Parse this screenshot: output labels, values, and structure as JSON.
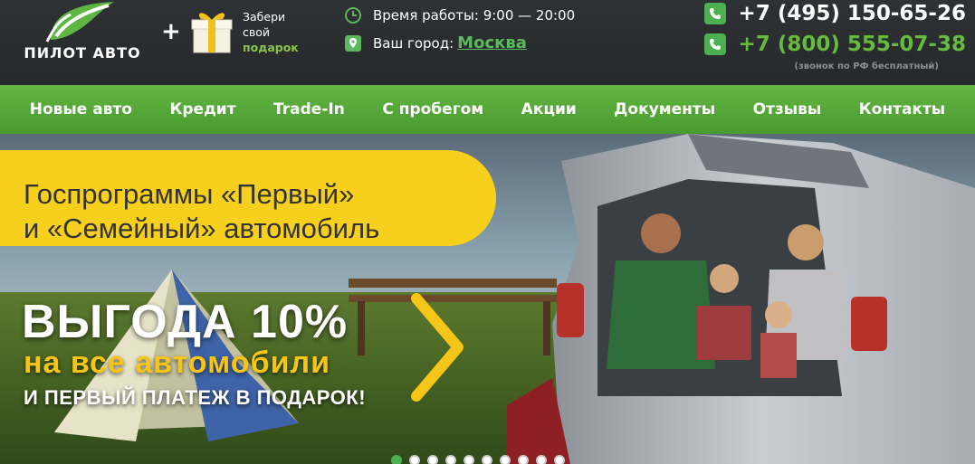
{
  "header": {
    "logo_text": "ПИЛОТ АВТО",
    "plus": "+",
    "gift": {
      "line1": "Забери",
      "line2": "свой",
      "line3": "подарок"
    },
    "hours": "Время работы: 9:00 — 20:00",
    "city_label": "Ваш город:",
    "city": "Москва",
    "phone1": "+7 (495) 150-65-26",
    "phone2": "+7 (800) 555-07-38",
    "phone_note": "(звонок по РФ бесплатный)"
  },
  "nav": {
    "items": [
      "Новые авто",
      "Кредит",
      "Trade-In",
      "С пробегом",
      "Акции",
      "Документы",
      "Отзывы",
      "Контакты"
    ]
  },
  "hero": {
    "banner_line1": "Госпрограммы «Первый»",
    "banner_line2": "и «Семейный» автомобиль",
    "benefit_big": "ВЫГОДА 10%",
    "benefit_yellow": "на все автомобили",
    "benefit_white": "И ПЕРВЫЙ ПЛАТЕЖ В ПОДАРОК!",
    "slide_count": 10,
    "active_slide": 0
  },
  "colors": {
    "accent_green": "#5cb85c",
    "nav_green": "#58a83b",
    "banner_yellow": "#f7cf1d",
    "header_bg": "#2a2d2f"
  }
}
